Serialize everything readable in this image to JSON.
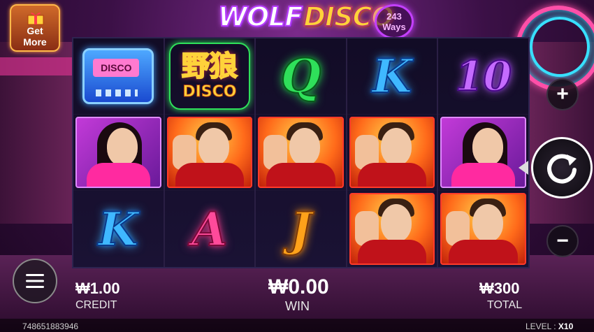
{
  "game": {
    "logo_part1": "WOLF",
    "logo_part2": "DISCO",
    "ways_number": "243",
    "ways_label": "Ways"
  },
  "promo": {
    "label_line1": "Get",
    "label_line2": "More"
  },
  "reels": [
    [
      "pager",
      "lady",
      "K"
    ],
    [
      "wild",
      "man",
      "A"
    ],
    [
      "Q",
      "man",
      "J"
    ],
    [
      "K",
      "man",
      "man"
    ],
    [
      "10",
      "lady",
      "man"
    ]
  ],
  "symbols": {
    "pager_text": "DISCO",
    "wild_text_cn": "野狼",
    "wild_text_en": "DISCO",
    "letters": {
      "Q": "Q",
      "K": "K",
      "A": "A",
      "J": "J",
      "10": "10"
    }
  },
  "controls": {
    "plus": "+",
    "minus": "−",
    "menu": "☰",
    "spin": "↻"
  },
  "info": {
    "credit_value": "₩1.00",
    "credit_label": "CREDIT",
    "win_value": "₩0.00",
    "win_label": "WIN",
    "total_value": "₩300",
    "total_label": "TOTAL"
  },
  "footer": {
    "round_id": "748651883946",
    "level_label": "LEVEL : ",
    "level_value": "X10"
  },
  "colors": {
    "accent_pink": "#ff4fa8",
    "accent_cyan": "#38e0ff",
    "reel_bg": "#120c26"
  }
}
